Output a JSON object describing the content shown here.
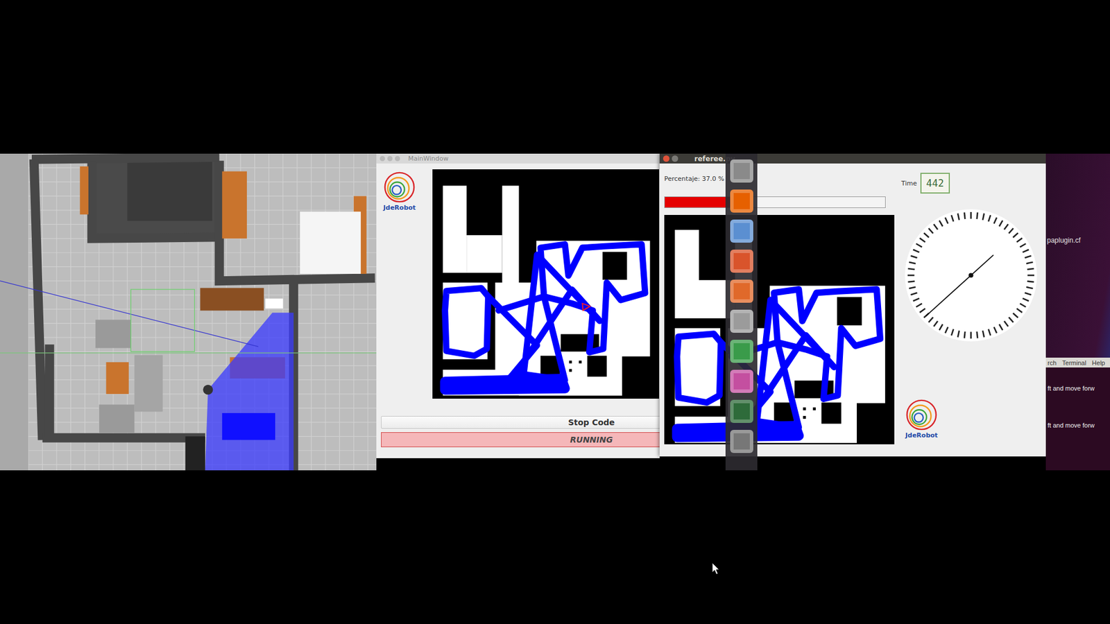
{
  "main_window": {
    "title": "MainWindow",
    "logo": "JdeRobot",
    "stop_button": "Stop Code",
    "status": "RUNNING",
    "map": {
      "robot_marker": true
    }
  },
  "referee_window": {
    "title": "referee.py",
    "percentage_label": "Percentaje: 37.0 %",
    "progress": {
      "level": 0.37
    },
    "time_label": "Time",
    "time_value": "442",
    "clock": {
      "level": 0.633
    },
    "logo": "JdeRobot",
    "map": {
      "robot_marker": false
    }
  },
  "launcher": {
    "icons": [
      {
        "color": "#8a8a8a"
      },
      {
        "color": "#e66000"
      },
      {
        "color": "#5b8fd1"
      },
      {
        "color": "#d9542b"
      },
      {
        "color": "#e0692a"
      },
      {
        "color": "#9b9b9b"
      },
      {
        "color": "#3a9b4a"
      },
      {
        "color": "#c44fa0"
      },
      {
        "color": "#2e6b3a"
      },
      {
        "color": "#777777"
      }
    ]
  },
  "terminal": {
    "top_text": "paplugin.cf",
    "menu": [
      "rch",
      "Terminal",
      "Help"
    ],
    "lines": [
      "ft and move forw",
      "ft and move forw"
    ]
  }
}
